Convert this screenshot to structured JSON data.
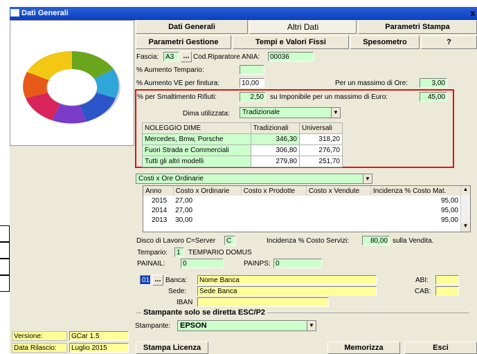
{
  "window": {
    "title": "Dati Generali",
    "close": "x"
  },
  "tabs": [
    "Dati Generali",
    "Altri Dati",
    "Parametri Stampa",
    "Parametri Gestione",
    "Tempi e Valori Fissi",
    "Spesometro",
    "?"
  ],
  "fascia": {
    "label": "Fascia:",
    "value": "A3",
    "dots": "...",
    "cod_label": "Cod.Riparatore ANIA:",
    "cod_value": "00036"
  },
  "aumenti": {
    "tempario_label": "% Aumento Tempario:",
    "tempario_value": "",
    "ve_label": "% Aumento VE per finitura:",
    "ve_value": "10,00",
    "ore_label": "Per un massimo di Ore:",
    "ore_value": "3,00"
  },
  "smalt": {
    "label": "% per Smaltimento Rifiuti:",
    "value": "2,50",
    "imp_label": "su Imponibile per un massimo di Euro:",
    "imp_value": "45,00"
  },
  "dima": {
    "label": "Dima utilizzata:",
    "value": "Tradizionale",
    "headers": [
      "NOLEGGIO DIME",
      "Tradizionali",
      "Universali"
    ],
    "rows": [
      [
        "Mercedes, Bmw, Porsche",
        "346,30",
        "318,20"
      ],
      [
        "Fuori Strada e Commerciali",
        "306,80",
        "276,70"
      ],
      [
        "Tutti gli altri modelli",
        "279,80",
        "251,70"
      ]
    ]
  },
  "costi": {
    "combo": "Costi x Ore Ordinarie",
    "headers": [
      "Anno",
      "Costo x Ordinarie",
      "Costo x Prodotte",
      "Costo x Vendute",
      "Incidenza % Costo Mat."
    ],
    "rows": [
      [
        "2015",
        "27,00",
        "",
        "",
        "95,00"
      ],
      [
        "2014",
        "27,00",
        "",
        "",
        "95,00"
      ],
      [
        "2013",
        "30,00",
        "",
        "",
        "95,00"
      ]
    ]
  },
  "disco": {
    "label": "Disco di Lavoro C=Server",
    "value": "C",
    "inc_label": "Incidenza % Costo Servizi:",
    "inc_value": "80,00",
    "vend_label": "sulla Vendita."
  },
  "tempario": {
    "label": "Tempario:",
    "num": "1",
    "name": "TEMPARIO DOMUS"
  },
  "pa": {
    "inail_label": "PAINAIL:",
    "inail_value": "0",
    "inps_label": "PAINPS:",
    "inps_value": "0"
  },
  "banca": {
    "code": "01",
    "dots": "...",
    "banca_label": "Banca:",
    "banca_value": "Nome Banca",
    "sede_label": "Sede:",
    "sede_value": "Sede Banca",
    "iban_label": "IBAN",
    "abi_label": "ABI:",
    "cab_label": "CAB:"
  },
  "stampanti": {
    "section": "Stampante solo se diretta ESC/P2",
    "label": "Stampante:",
    "value": "EPSON"
  },
  "info": {
    "versione_label": "Versione:",
    "versione_value": "GCar 1.5",
    "data_label": "Data Rilascio:",
    "data_value": "Luglio 2015"
  },
  "buttons": {
    "licenza": "Stampa Licenza",
    "memorizza": "Memorizza",
    "esci": "Esci"
  },
  "colors": {
    "highlight": "#e01010",
    "green_field": "#ccffcc",
    "yellow_field": "#ffff99"
  }
}
